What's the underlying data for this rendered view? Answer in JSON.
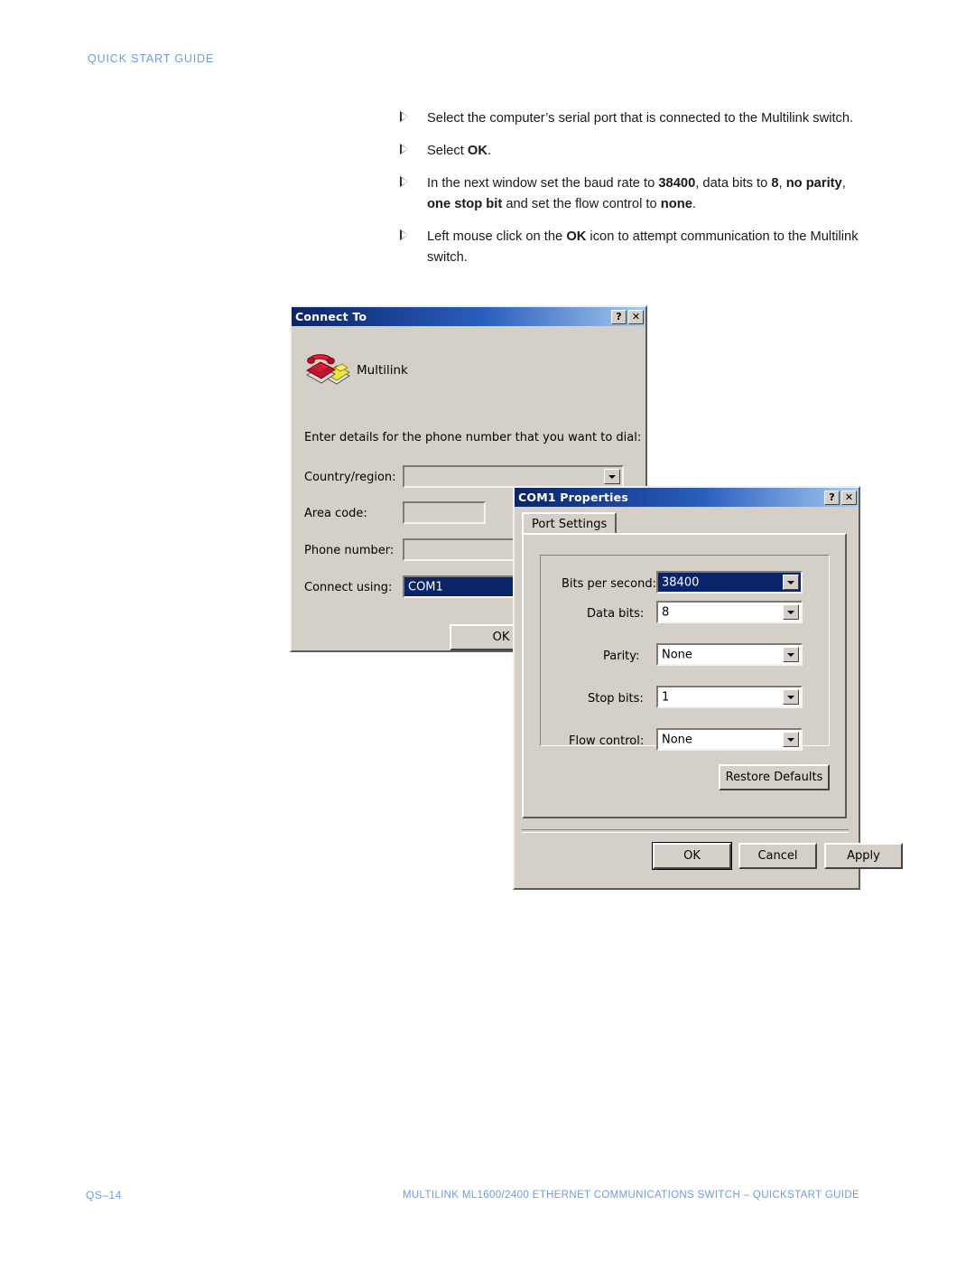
{
  "page": {
    "header": "QUICK START GUIDE",
    "footer_left": "QS–14",
    "footer_right": "MULTILINK ML1600/2400 ETHERNET COMMUNICATIONS SWITCH – QUICKSTART GUIDE"
  },
  "instructions": [
    {
      "parts": [
        {
          "text": "Select the computer’s serial port that is connected to the Multilink switch.",
          "bold": false
        }
      ]
    },
    {
      "parts": [
        {
          "text": "Select ",
          "bold": false
        },
        {
          "text": "OK",
          "bold": true
        },
        {
          "text": ".",
          "bold": false
        }
      ]
    },
    {
      "parts": [
        {
          "text": "In the next window set the baud rate to ",
          "bold": false
        },
        {
          "text": "38400",
          "bold": true
        },
        {
          "text": ", data bits to ",
          "bold": false
        },
        {
          "text": "8",
          "bold": true
        },
        {
          "text": ", ",
          "bold": false
        },
        {
          "text": "no parity",
          "bold": true
        },
        {
          "text": ", ",
          "bold": false
        },
        {
          "text": "one stop bit",
          "bold": true
        },
        {
          "text": " and set the flow control to ",
          "bold": false
        },
        {
          "text": "none",
          "bold": true
        },
        {
          "text": ".",
          "bold": false
        }
      ]
    },
    {
      "parts": [
        {
          "text": "Left mouse click on the ",
          "bold": false
        },
        {
          "text": "OK",
          "bold": true
        },
        {
          "text": " icon to attempt communication to the Multilink switch.",
          "bold": false
        }
      ]
    }
  ],
  "connect_to_dialog": {
    "title": "Connect To",
    "help_button": "?",
    "close_button": "✕",
    "connection_name": "Multilink",
    "prompt": "Enter details for the phone number that you want to dial:",
    "fields": [
      {
        "label": "Country/region:",
        "value": ""
      },
      {
        "label": "Area code:",
        "value": ""
      },
      {
        "label": "Phone number:",
        "value": ""
      },
      {
        "label": "Connect using:",
        "value": "COM1"
      }
    ],
    "ok_button": "OK"
  },
  "com1_properties_dialog": {
    "title": "COM1 Properties",
    "help_button": "?",
    "close_button": "✕",
    "tab": "Port Settings",
    "settings": [
      {
        "label": "Bits per second:",
        "value": "38400"
      },
      {
        "label": "Data bits:",
        "value": "8"
      },
      {
        "label": "Parity:",
        "value": "None"
      },
      {
        "label": "Stop bits:",
        "value": "1"
      },
      {
        "label": "Flow control:",
        "value": "None"
      }
    ],
    "restore_defaults_button": "Restore Defaults",
    "ok_button": "OK",
    "cancel_button": "Cancel",
    "apply_button": "Apply"
  },
  "colors": {
    "accent_blue": "#6f9ae8",
    "title_dark": "#0a246a",
    "dialog_face": "#d4d0c8",
    "selection": "#0a246a"
  }
}
